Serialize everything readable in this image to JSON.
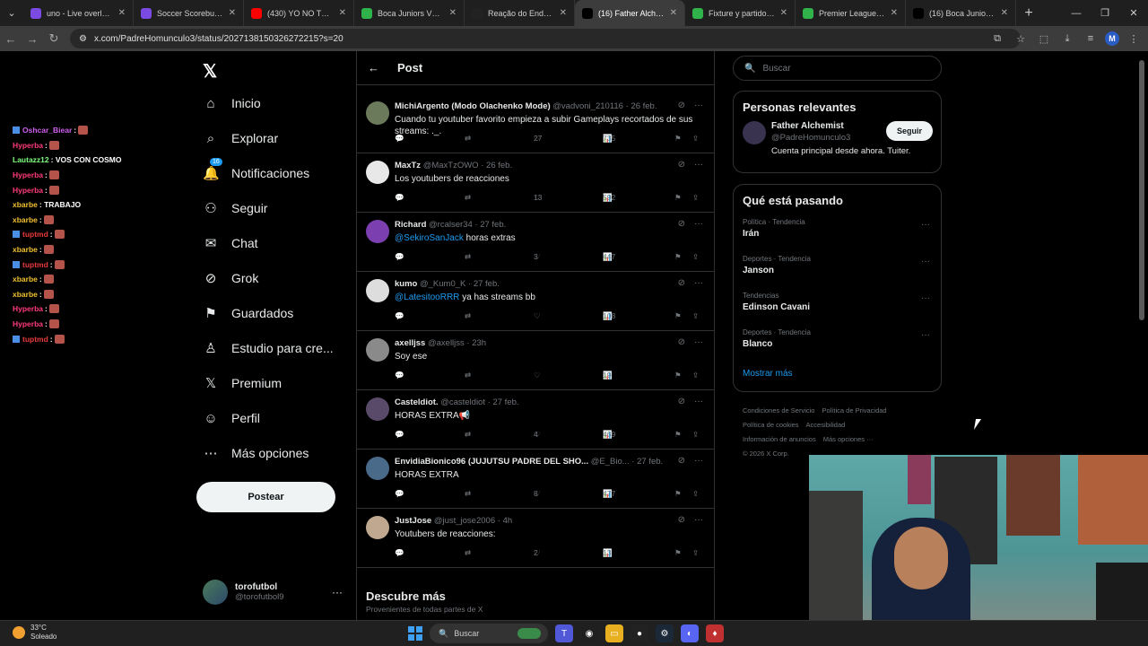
{
  "browser": {
    "tabs": [
      {
        "title": "uno - Live overlays fo",
        "icon": "u-icon",
        "color": "#7b4ae2",
        "active": false
      },
      {
        "title": "Soccer Scorebug | Fre",
        "icon": "u-icon",
        "color": "#7b4ae2",
        "active": false
      },
      {
        "title": "(430) YO NO TE MER",
        "icon": "youtube-icon",
        "color": "#ff0000",
        "active": false
      },
      {
        "title": "Boca Juniors Vs Gim",
        "icon": "globe-icon",
        "color": "#2fb34a",
        "active": false
      },
      {
        "title": "Reação do Endrick n",
        "icon": "tiktok-icon",
        "color": "#222222",
        "active": false
      },
      {
        "title": "(16) Father Alchemis",
        "icon": "x-icon",
        "color": "#000000",
        "active": true
      },
      {
        "title": "Fixture y partidos de",
        "icon": "globe-icon",
        "color": "#2fb34a",
        "active": false
      },
      {
        "title": "Premier League - PO",
        "icon": "globe-icon",
        "color": "#2fb34a",
        "active": false
      },
      {
        "title": "(16) Boca Juniors - La",
        "icon": "x-icon",
        "color": "#000000",
        "active": false
      }
    ],
    "url": "x.com/PadreHomunculo3/status/2027138150326272215?s=20",
    "profile_initial": "M"
  },
  "stream_chat": [
    {
      "user": "Oshcar_Biear",
      "color": "#d060f0",
      "msg": ":",
      "emote": true,
      "badge": true
    },
    {
      "user": "Hyperba",
      "color": "#ff3b7a",
      "msg": ":",
      "emote": true,
      "badge": false
    },
    {
      "user": "Lautazz12",
      "color": "#7fff7f",
      "msg": ": VOS CON COSMO",
      "emote": false,
      "badge": false
    },
    {
      "user": "Hyperba",
      "color": "#ff3b7a",
      "msg": ":",
      "emote": true,
      "badge": false
    },
    {
      "user": "Hyperba",
      "color": "#ff3b7a",
      "msg": ":",
      "emote": true,
      "badge": false
    },
    {
      "user": "xbarbe",
      "color": "#f0c030",
      "msg": ": TRABAJO",
      "emote": false,
      "badge": false
    },
    {
      "user": "xbarbe",
      "color": "#f0c030",
      "msg": ":",
      "emote": true,
      "badge": false
    },
    {
      "user": "tuptmd",
      "color": "#e83a3a",
      "msg": ":",
      "emote": true,
      "badge": true
    },
    {
      "user": "xbarbe",
      "color": "#f0c030",
      "msg": ":",
      "emote": true,
      "badge": false
    },
    {
      "user": "tuptmd",
      "color": "#e83a3a",
      "msg": ":",
      "emote": true,
      "badge": true
    },
    {
      "user": "xbarbe",
      "color": "#f0c030",
      "msg": ":",
      "emote": true,
      "badge": false
    },
    {
      "user": "xbarbe",
      "color": "#f0c030",
      "msg": ":",
      "emote": true,
      "badge": false
    },
    {
      "user": "Hyperba",
      "color": "#ff3b7a",
      "msg": ":",
      "emote": true,
      "badge": false
    },
    {
      "user": "Hyperba",
      "color": "#ff3b7a",
      "msg": ":",
      "emote": true,
      "badge": false
    },
    {
      "user": "tuptmd",
      "color": "#e83a3a",
      "msg": ":",
      "emote": true,
      "badge": true
    }
  ],
  "nav": {
    "items": [
      {
        "label": "Inicio",
        "icon": "home-icon"
      },
      {
        "label": "Explorar",
        "icon": "search-icon"
      },
      {
        "label": "Notificaciones",
        "icon": "bell-icon",
        "badge": "16"
      },
      {
        "label": "Seguir",
        "icon": "follow-icon"
      },
      {
        "label": "Chat",
        "icon": "mail-icon"
      },
      {
        "label": "Grok",
        "icon": "grok-icon"
      },
      {
        "label": "Guardados",
        "icon": "bookmark-icon"
      },
      {
        "label": "Estudio para cre...",
        "icon": "studio-icon"
      },
      {
        "label": "Premium",
        "icon": "x-icon"
      },
      {
        "label": "Perfil",
        "icon": "person-icon"
      },
      {
        "label": "Más opciones",
        "icon": "more-icon"
      }
    ],
    "post_button": "Postear",
    "account": {
      "name": "torofutbol",
      "handle": "@torofutbol9"
    }
  },
  "feed": {
    "title": "Post",
    "tweets": [
      {
        "name": "MichiArgento (Modo Olachenko Mode)",
        "handle": "@vadvoni_210116",
        "time": "26 feb.",
        "body": "Cuando tu youtuber favorito empieza a subir Gameplays recortados de sus streams: ._.",
        "mention": "",
        "likes": "27",
        "views": "735",
        "av": "#6a7a5a"
      },
      {
        "name": "MaxTz",
        "handle": "@MaxTzOWO",
        "time": "26 feb.",
        "body": "Los youtubers de reacciones",
        "mention": "",
        "likes": "13",
        "views": "592",
        "av": "#e8e8e8"
      },
      {
        "name": "Richard",
        "handle": "@rcalser34",
        "time": "27 feb.",
        "body": "horas extras",
        "mention": "@SekiroSanJack",
        "likes": "3",
        "views": "447",
        "av": "#7b3fb0"
      },
      {
        "name": "kumo",
        "handle": "@_Kum0_K",
        "time": "27 feb.",
        "body": "ya has streams bb",
        "mention": "@LatesitooRRR",
        "likes": "",
        "views": "108",
        "av": "#dddddd"
      },
      {
        "name": "axelljss",
        "handle": "@axelljss",
        "time": "23h",
        "body": "Soy ese",
        "mention": "",
        "likes": "",
        "views": "19",
        "av": "#8a8a8a"
      },
      {
        "name": "Casteldiot.",
        "handle": "@casteldiot",
        "time": "27 feb.",
        "body": "HORAS EXTRA📢",
        "mention": "",
        "likes": "4",
        "views": "469",
        "av": "#5a4a6a"
      },
      {
        "name": "EnvidiaBionico96 (JUJUTSU PADRE DEL SHO...",
        "handle": "@E_Bio...",
        "time": "27 feb.",
        "body": "HORAS EXTRA",
        "mention": "",
        "likes": "8",
        "views": "477",
        "av": "#4a6a8a"
      },
      {
        "name": "JustJose",
        "handle": "@just_jose2006",
        "time": "4h",
        "body": "Youtubers de reacciones:",
        "mention": "",
        "likes": "2",
        "views": "13",
        "av": "#c0a890"
      }
    ],
    "discover_title": "Descubre más",
    "discover_sub": "Provenientes de todas partes de X"
  },
  "sidebar": {
    "search_placeholder": "Buscar",
    "relevant_title": "Personas relevantes",
    "relevant": {
      "name": "Father Alchemist",
      "handle": "@PadreHomunculo3",
      "bio": "Cuenta principal desde ahora. Tuiter.",
      "follow": "Seguir"
    },
    "trending_title": "Qué está pasando",
    "trends": [
      {
        "category": "Política · Tendencia",
        "name": "Irán"
      },
      {
        "category": "Deportes · Tendencia",
        "name": "Janson"
      },
      {
        "category": "Tendencias",
        "name": "Edinson Cavani"
      },
      {
        "category": "Deportes · Tendencia",
        "name": "Blanco"
      }
    ],
    "show_more": "Mostrar más",
    "footer": [
      "Condiciones de Servicio",
      "Política de Privacidad",
      "Política de cookies",
      "Accesibilidad",
      "Información de anuncios",
      "Más opciones ···",
      "© 2026 X Corp."
    ]
  },
  "taskbar": {
    "temp": "33°C",
    "weather": "Soleado",
    "search": "Buscar"
  }
}
